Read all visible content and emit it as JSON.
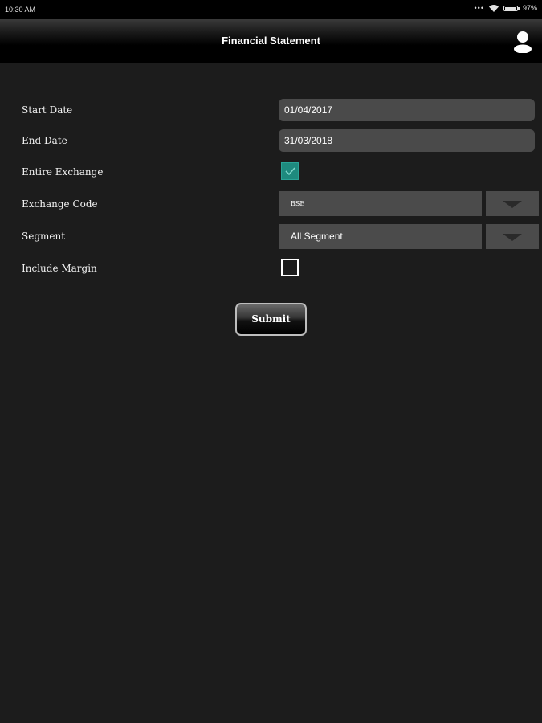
{
  "status_bar": {
    "time": "10:30 AM",
    "more": "•••",
    "battery": "97%"
  },
  "header": {
    "title": "Financial Statement"
  },
  "form": {
    "start_date": {
      "label": "Start Date",
      "value": "01/04/2017"
    },
    "end_date": {
      "label": "End Date",
      "value": "31/03/2018"
    },
    "entire_exchange": {
      "label": "Entire Exchange",
      "checked": true
    },
    "exchange_code": {
      "label": "Exchange Code",
      "value": "BSE"
    },
    "segment": {
      "label": "Segment",
      "value": "All Segment"
    },
    "include_margin": {
      "label": "Include Margin",
      "checked": false
    },
    "submit_label": "Submit"
  },
  "colors": {
    "background": "#1c1c1c",
    "field": "#4a4a4a",
    "accent_checkbox": "#1e8a7e"
  }
}
